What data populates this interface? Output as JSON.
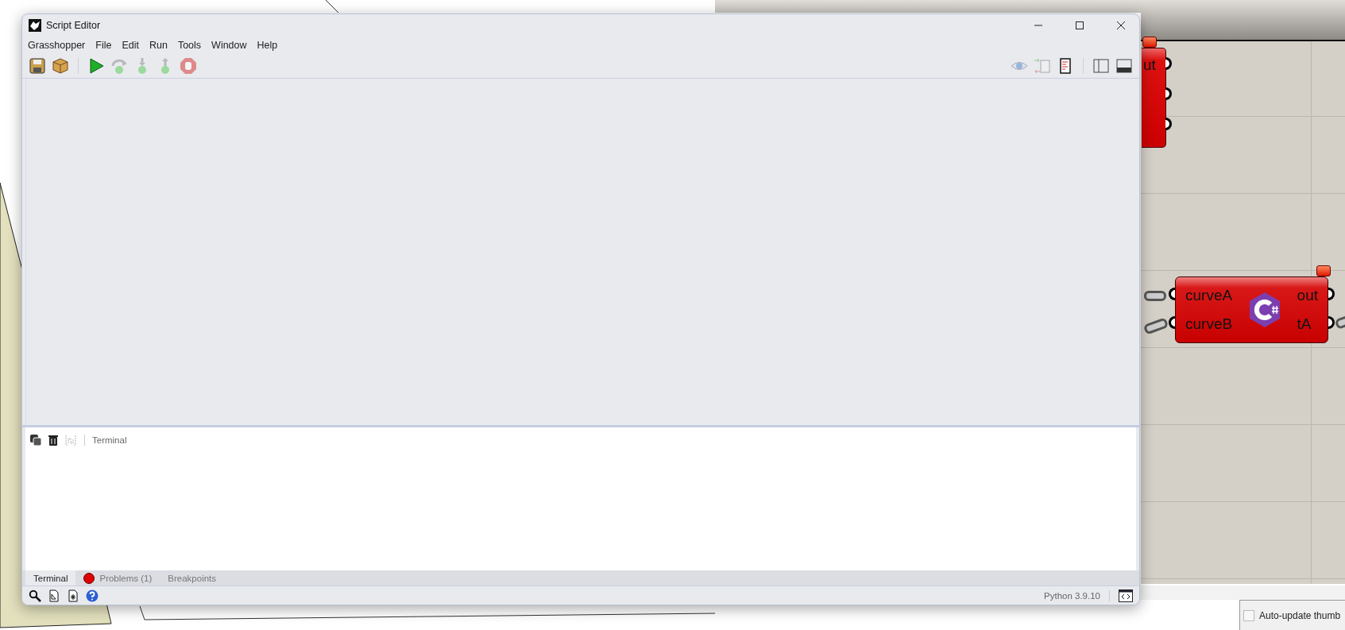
{
  "window": {
    "title": "Script Editor",
    "menu": [
      "Grasshopper",
      "File",
      "Edit",
      "Run",
      "Tools",
      "Window",
      "Help"
    ],
    "toolbar_left": [
      {
        "kind": "save",
        "disabled": false
      },
      {
        "kind": "package",
        "disabled": false
      },
      {
        "kind": "separator"
      },
      {
        "kind": "run",
        "disabled": false
      },
      {
        "kind": "step-over",
        "disabled": true
      },
      {
        "kind": "step-in",
        "disabled": true
      },
      {
        "kind": "step-out",
        "disabled": true
      },
      {
        "kind": "stop",
        "disabled": true
      }
    ],
    "toolbar_right": [
      {
        "kind": "eye",
        "disabled": true
      },
      {
        "kind": "compare",
        "disabled": true
      },
      {
        "kind": "document",
        "disabled": false
      },
      {
        "kind": "separator"
      },
      {
        "kind": "side-panel",
        "disabled": false
      },
      {
        "kind": "bottom-panel",
        "disabled": false
      }
    ],
    "terminal": {
      "tools": [
        {
          "kind": "copy",
          "disabled": false
        },
        {
          "kind": "trash",
          "disabled": false
        },
        {
          "kind": "wrap",
          "disabled": true
        }
      ],
      "label": "Terminal"
    },
    "panel_tabs": [
      {
        "label": "Terminal",
        "selected": true,
        "alert": false
      },
      {
        "label": "Problems (1)",
        "selected": false,
        "alert": true
      },
      {
        "label": "Breakpoints",
        "selected": false,
        "alert": false
      }
    ],
    "status_bar": {
      "tools": [
        {
          "kind": "search"
        },
        {
          "kind": "doc"
        },
        {
          "kind": "doc-star"
        },
        {
          "kind": "help"
        }
      ],
      "language": "Python 3.9.10"
    }
  },
  "canvas": {
    "nodes": [
      {
        "kind": "partial",
        "warning": true,
        "label": "ut",
        "outputs": [
          {
            "kind": "port"
          },
          {
            "kind": "port"
          },
          {
            "kind": "port"
          }
        ]
      },
      {
        "kind": "csharp",
        "warning": true,
        "inputs": [
          {
            "label": "curveA",
            "wired": true
          },
          {
            "label": "curveB",
            "wired": true
          }
        ],
        "outputs": [
          {
            "label": "out",
            "wired": false
          },
          {
            "label": "tA",
            "wired": true
          }
        ]
      }
    ]
  },
  "thumbnail_panel": {
    "checkbox": {
      "label": "Auto-update thumb",
      "checked": false
    }
  }
}
